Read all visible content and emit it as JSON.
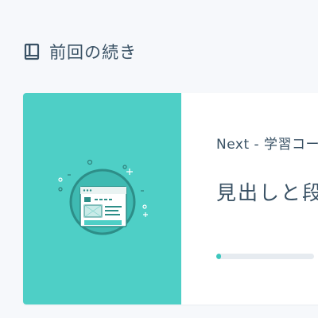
{
  "section": {
    "title": "前回の続き",
    "icon": "book-icon"
  },
  "card": {
    "image_icon": "browser-window-illustration",
    "next_label": "Next - 学習コース",
    "title": "見出しと段落",
    "progress_fraction": 0.05
  },
  "colors": {
    "accent": "#4ecfc6",
    "progress": "#3dc7bd",
    "text": "#3a5265",
    "background": "#f6f8fb"
  }
}
